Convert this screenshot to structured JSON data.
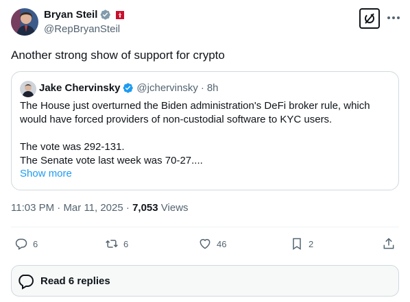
{
  "author": {
    "name": "Bryan Steil",
    "handle": "@RepBryanSteil"
  },
  "tweet": {
    "text": "Another strong show of support for crypto"
  },
  "quote": {
    "name": "Jake Chervinsky",
    "handle": "@jchervinsky",
    "separator": "·",
    "time": "8h",
    "lines": [
      "The House just overturned the Biden administration's DeFi broker rule, which",
      "would have forced providers of non-custodial software to KYC users.",
      "",
      "The vote was 292-131.",
      "The Senate vote last week was 70-27...."
    ],
    "show_more": "Show more"
  },
  "meta": {
    "time": "11:03 PM",
    "date": "Mar 11, 2025",
    "sep": "·",
    "views_count": "7,053",
    "views_label": "Views"
  },
  "actions": {
    "replies": "6",
    "reposts": "6",
    "likes": "46",
    "bookmarks": "2"
  },
  "read_replies": {
    "label": "Read 6 replies"
  },
  "icons": [
    "verified-gray-icon",
    "flag-badge-icon",
    "grok-icon",
    "more-icon",
    "verified-blue-icon",
    "reply-icon",
    "repost-icon",
    "like-icon",
    "bookmark-icon",
    "share-icon",
    "replies-bubble-icon"
  ],
  "colors": {
    "accent": "#1d9bf0",
    "text": "#0f1419",
    "muted": "#536471",
    "border": "#cfd9de"
  }
}
